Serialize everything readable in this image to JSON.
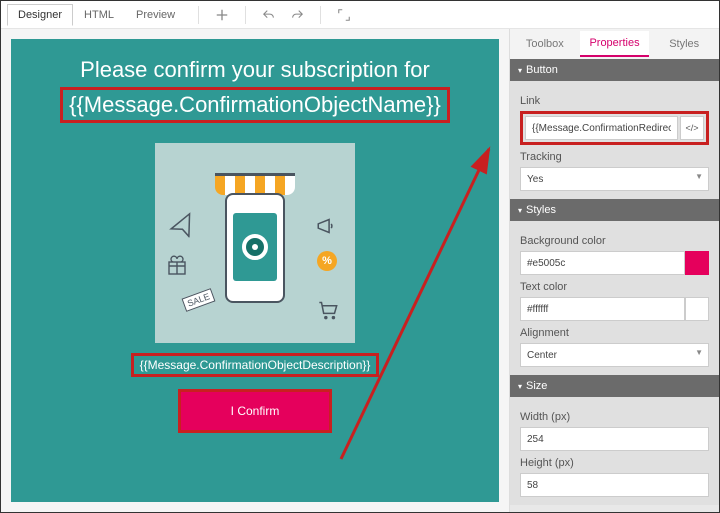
{
  "topTabs": {
    "designer": "Designer",
    "html": "HTML",
    "preview": "Preview"
  },
  "canvas": {
    "title": "Please confirm your subscription for",
    "objectNameToken": "{{Message.ConfirmationObjectName}}",
    "descToken": "{{Message.ConfirmationObjectDescription}}",
    "confirmLabel": "I Confirm"
  },
  "panelTabs": {
    "toolbox": "Toolbox",
    "properties": "Properties",
    "styles": "Styles"
  },
  "section": {
    "button": "Button",
    "linkLabel": "Link",
    "linkValue": "{{Message.ConfirmationRedirectURL}}",
    "trackingLabel": "Tracking",
    "trackingValue": "Yes",
    "styles": "Styles",
    "bgColorLabel": "Background color",
    "bgColorValue": "#e5005c",
    "textColorLabel": "Text color",
    "textColorValue": "#ffffff",
    "alignLabel": "Alignment",
    "alignValue": "Center",
    "size": "Size",
    "widthLabel": "Width (px)",
    "widthValue": "254",
    "heightLabel": "Height (px)",
    "heightValue": "58"
  }
}
